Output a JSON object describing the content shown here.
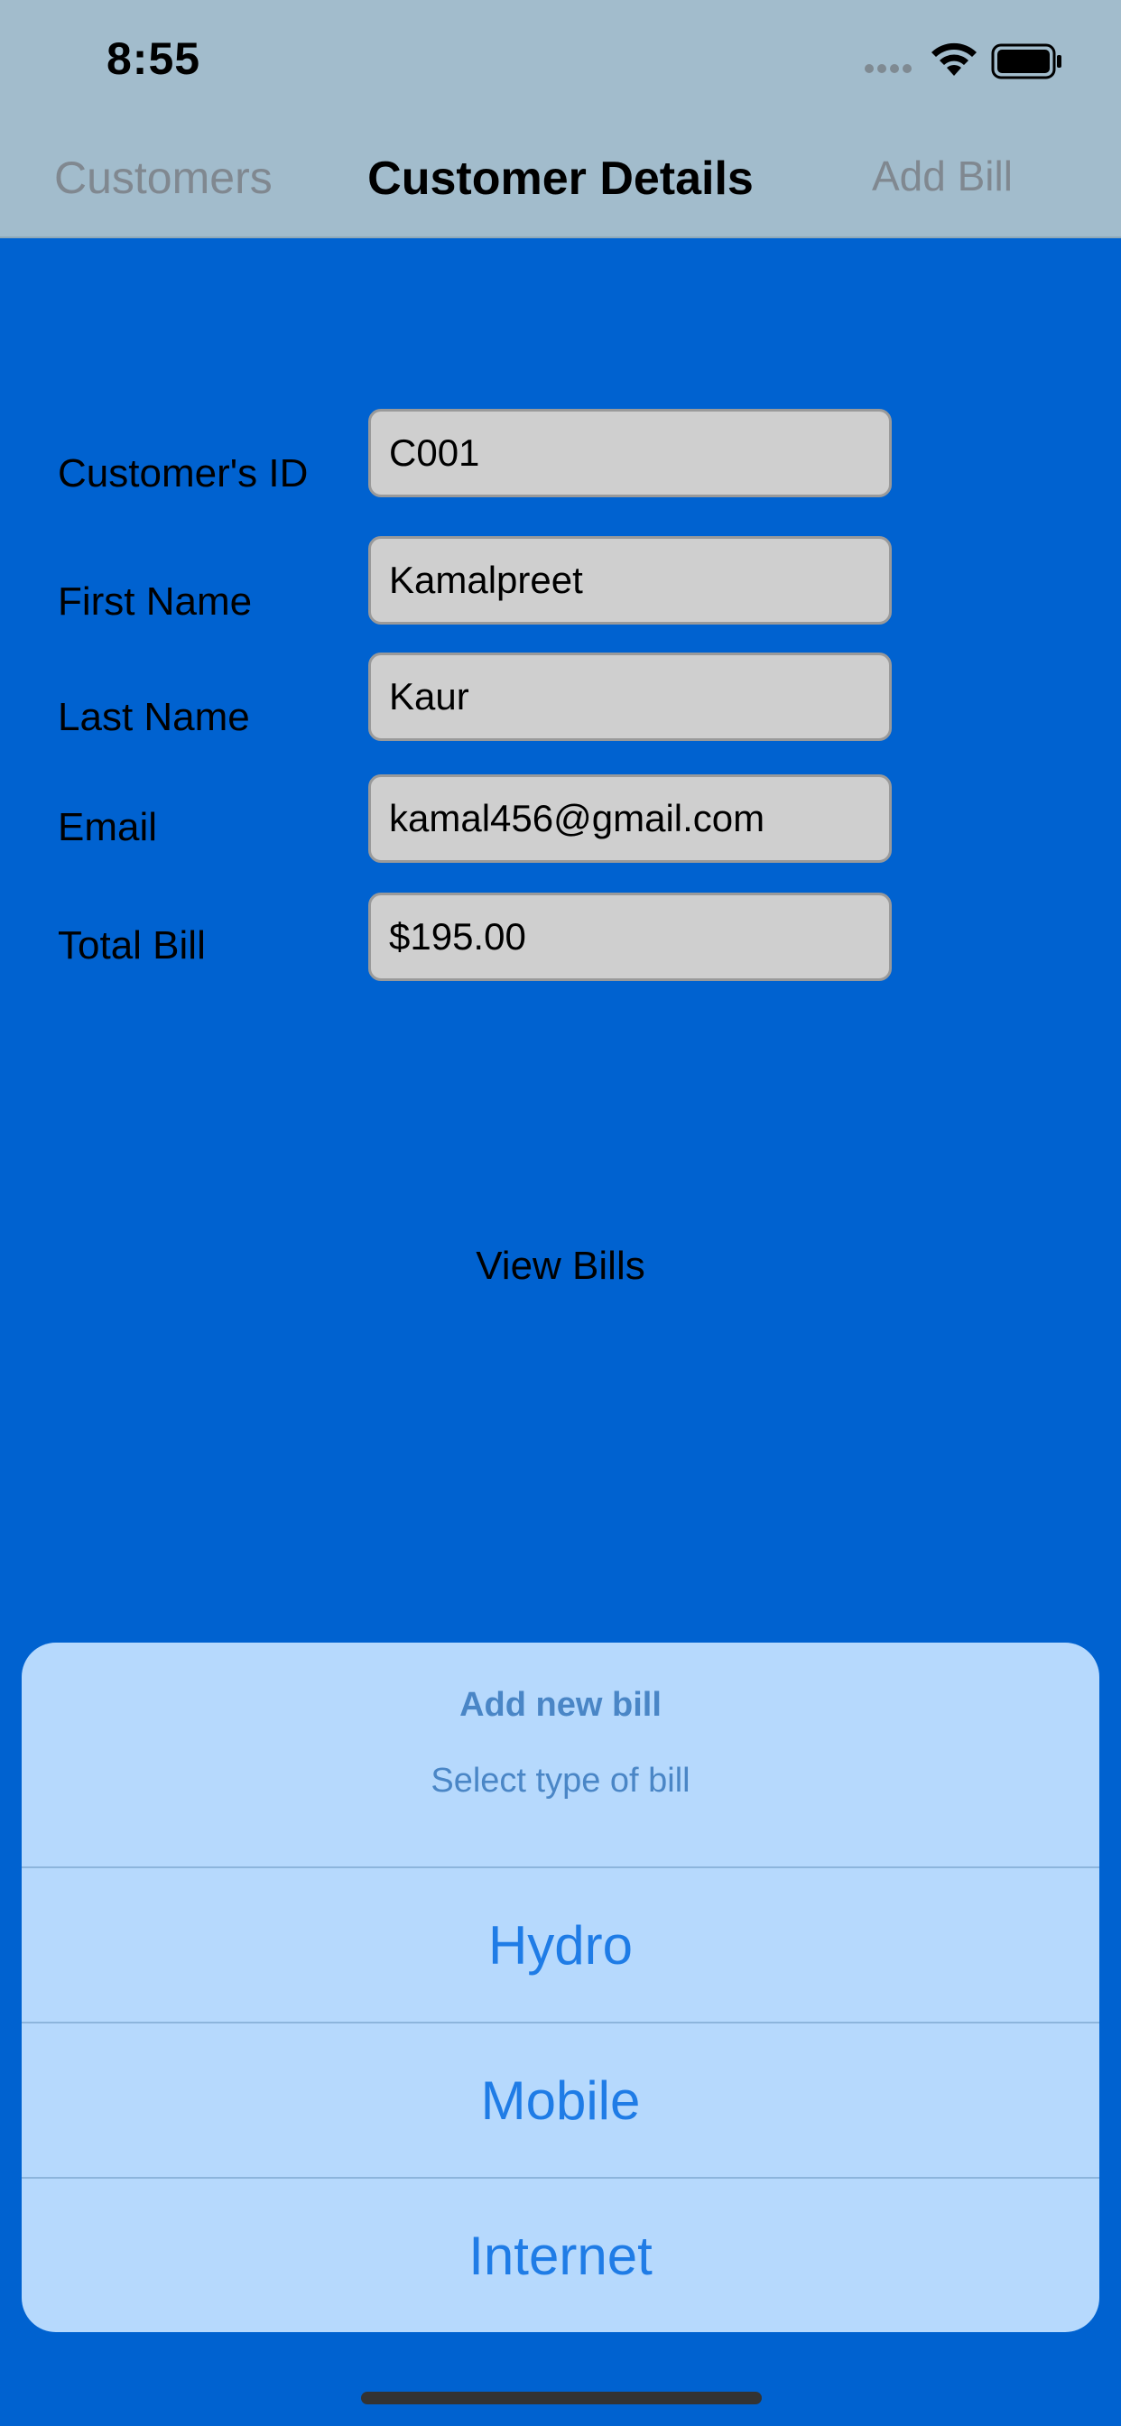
{
  "status_bar": {
    "time": "8:55"
  },
  "nav": {
    "back_label": "Customers",
    "title": "Customer Details",
    "right_label": "Add Bill"
  },
  "form": {
    "customer_id_label": "Customer's ID",
    "customer_id_value": "C001",
    "first_name_label": "First Name",
    "first_name_value": "Kamalpreet",
    "last_name_label": "Last Name",
    "last_name_value": "Kaur",
    "email_label": "Email",
    "email_value": "kamal456@gmail.com",
    "total_bill_label": "Total Bill",
    "total_bill_value": "$195.00"
  },
  "view_bills_label": "View Bills",
  "action_sheet": {
    "title": "Add new bill",
    "subtitle": "Select type of bill",
    "options": [
      "Hydro",
      "Mobile",
      "Internet"
    ]
  },
  "colors": {
    "background": "#0062d0",
    "nav_bar": "#a2bccc",
    "sheet": "#b6d9fd",
    "accent": "#1f7ce6"
  }
}
